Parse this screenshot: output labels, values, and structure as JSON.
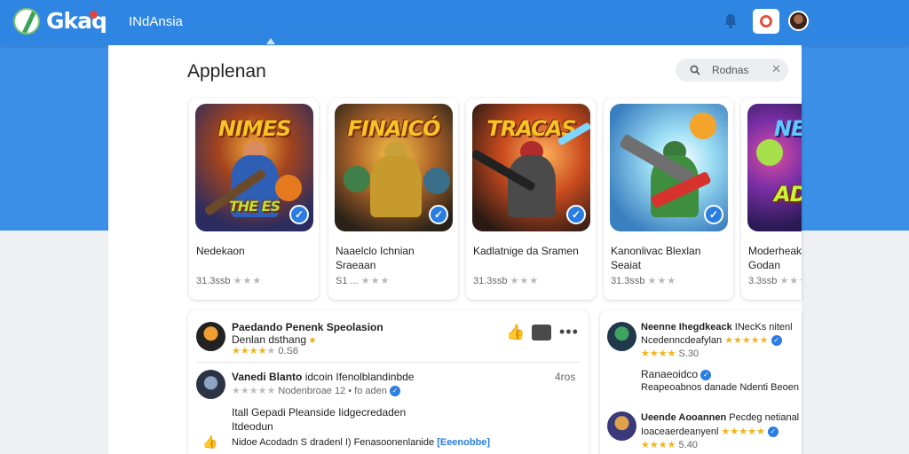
{
  "header": {
    "logo_text": "Gkaq",
    "app_name": "INdAnsia",
    "icons": [
      "logo-icon",
      "bell-icon",
      "notification-icon",
      "avatar"
    ]
  },
  "page": {
    "title": "Applenan",
    "search_placeholder": "Rodnas"
  },
  "cards": [
    {
      "art_title": "NIMES",
      "art_sub": "THE ES",
      "name": "Nedekaon",
      "rating": "31.3ssb",
      "stars": "★★★"
    },
    {
      "art_title": "FINAICÓ",
      "art_sub": "",
      "name": "Naaelclo Ichnian Sraeaan",
      "rating": "S1 ... ",
      "stars": "★★★"
    },
    {
      "art_title": "TRACAS",
      "art_sub": "",
      "name": "Kadlatnige da Sramen",
      "rating": "31.3ssb",
      "stars": "★★★"
    },
    {
      "art_title": "",
      "art_sub": "",
      "name": "Kanonlivac Blexlan Seaiat",
      "rating": "31.3ssb",
      "stars": "★★★"
    },
    {
      "art_title": "NE",
      "art_sub": "ADI",
      "name": "Moderheak Godan",
      "rating": "3.3ssb",
      "stars": "★★★"
    }
  ],
  "feed": {
    "post1": {
      "author": "Paedando Penenk Speolasion",
      "subtitle": "Denlan dsthang",
      "stars_filled": "★★★★",
      "stars_empty": "★",
      "meta": "0.S6"
    },
    "post2": {
      "author": "Vanedi Blanto",
      "author_rest": "idcoin Ifenolblandinbde",
      "stars": "★★★★★",
      "meta": "Nodenbroae 12 • fo aden",
      "time": "4ros"
    },
    "post3": {
      "line1": "Itall Gepadi Pleanside Iidgecredaden",
      "line2": "Itdeodun",
      "footer": "Nidoe Acodadn S dradenl I) Fenasoonenlanide",
      "footer_link": "[Eeenobbe]"
    }
  },
  "sidebar": [
    {
      "name": "Neenne Ihegdkeack",
      "tag": "INecKs nitenl",
      "sub": "Ncedenncdeafylan",
      "stars": "★★★★★",
      "rating": "S.30"
    },
    {
      "name": "Ranaeoidco",
      "sub": "Reapeoabnos danade Ndenti Beoen Reatan"
    },
    {
      "name": "Ueende Aooannen",
      "tag": "Pecdeg netianal",
      "sub": "Ioaceaerdeanyenl",
      "stars": "★★★★★",
      "rating": "5.40"
    }
  ],
  "colors": {
    "brand_blue": "#3b8fe6",
    "verified_blue": "#2a7de1",
    "star_gold": "#f3b31b"
  }
}
